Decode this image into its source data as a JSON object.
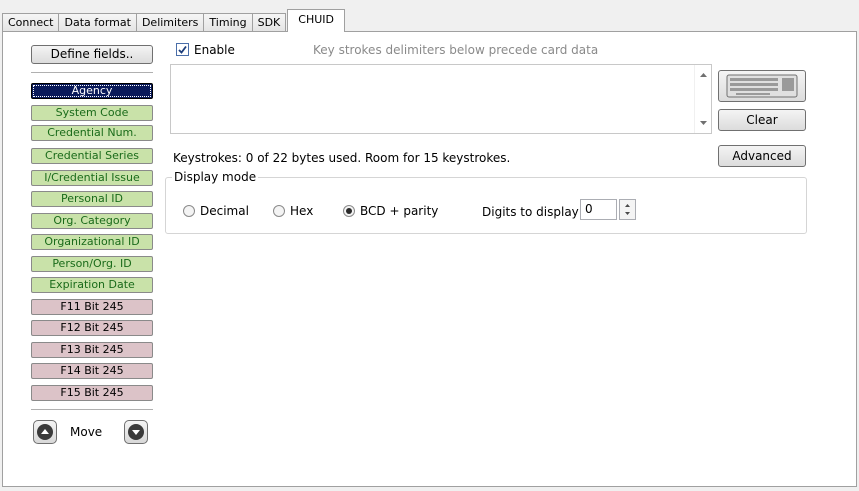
{
  "tabs": [
    "Connect",
    "Data format",
    "Delimiters",
    "Timing",
    "SDK",
    "CHUID"
  ],
  "active_tab": "CHUID",
  "left": {
    "define_fields_label": "Define fields..",
    "fields": [
      {
        "label": "Agency",
        "style": "selected"
      },
      {
        "label": "System Code",
        "style": "green"
      },
      {
        "label": "Credential Num.",
        "style": "green"
      },
      {
        "label": "Credential Series",
        "style": "green"
      },
      {
        "label": "I/Credential Issue",
        "style": "green"
      },
      {
        "label": "Personal ID",
        "style": "green"
      },
      {
        "label": "Org. Category",
        "style": "green"
      },
      {
        "label": "Organizational ID",
        "style": "green"
      },
      {
        "label": "Person/Org. ID",
        "style": "green"
      },
      {
        "label": "Expiration Date",
        "style": "green"
      },
      {
        "label": "F11 Bit 245",
        "style": "pink"
      },
      {
        "label": "F12 Bit 245",
        "style": "pink"
      },
      {
        "label": "F13 Bit 245",
        "style": "pink"
      },
      {
        "label": "F14 Bit 245",
        "style": "pink"
      },
      {
        "label": "F15 Bit 245",
        "style": "pink"
      }
    ],
    "move_label": "Move"
  },
  "enable": {
    "label": "Enable",
    "checked": true
  },
  "hint": "Key strokes delimiters below precede card data",
  "keystroke_text": "",
  "clear_label": "Clear",
  "advanced_label": "Advanced",
  "keystrokes_status": "Keystrokes: 0 of 22 bytes used. Room for 15 keystrokes.",
  "display_mode": {
    "legend": "Display mode",
    "options": [
      "Decimal",
      "Hex",
      "BCD + parity"
    ],
    "selected": "BCD + parity",
    "digits_label": "Digits to display",
    "digits_value": "0"
  },
  "colors": {
    "green_fill": "#c9e2a9",
    "green_text": "#1a6b1a",
    "pink_fill": "#dcc3c8",
    "selected_fill": "#0a1a5a"
  }
}
